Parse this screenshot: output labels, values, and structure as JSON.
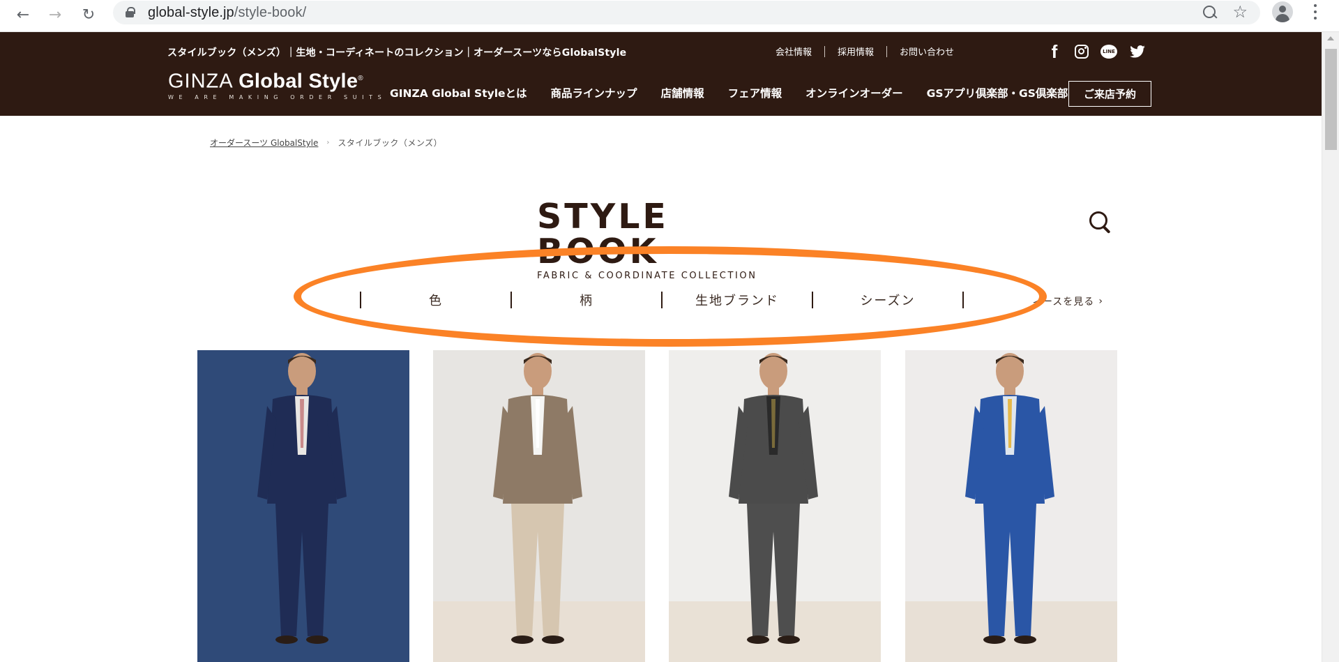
{
  "browser": {
    "url_domain": "global-style.jp",
    "url_path": "/style-book/"
  },
  "header": {
    "tagline": "スタイルブック（メンズ）｜生地・コーディネートのコレクション｜オーダースーツならGlobalStyle",
    "logo_part1": "GINZA ",
    "logo_part2": "Global Style",
    "logo_mark": "®",
    "logo_sub": "WE ARE MAKING ORDER SUITS",
    "util_links": [
      "会社情報",
      "採用情報",
      "お問い合わせ"
    ],
    "social": [
      "facebook-icon",
      "instagram-icon",
      "line-icon",
      "twitter-icon"
    ],
    "nav": [
      "GINZA Global Styleとは",
      "商品ラインナップ",
      "店舗情報",
      "フェア情報",
      "オンラインオーダー",
      "GSアプリ倶楽部・GS倶楽部"
    ],
    "reserve_label": "ご来店予約",
    "bg_color": "#2e1a12"
  },
  "breadcrumb": {
    "home": "オーダースーツ GlobalStyle",
    "separator": "›",
    "current": "スタイルブック（メンズ）"
  },
  "page": {
    "title": "STYLE BOOK",
    "subtitle": "FABRIC & COORDINATE COLLECTION"
  },
  "filters": {
    "tabs": [
      "色",
      "柄",
      "生地ブランド",
      "シーズン"
    ],
    "see_all": "ィースを見る"
  },
  "annotation_color": "#fb8226",
  "cards": [
    {
      "bg": "#2f4a78",
      "jacket": "#1f2c55",
      "trouser": "#1f2c55",
      "shirt": "#e9e7e4",
      "accent": "#c98a8a",
      "floor": "#2f4a78"
    },
    {
      "bg": "#e7e5e2",
      "jacket": "#8e7a66",
      "trouser": "#d6c6b0",
      "shirt": "#f5f5f3",
      "accent": "#ffffff",
      "floor": "#e8dfd4"
    },
    {
      "bg": "#efeeec",
      "jacket": "#4b4b4b",
      "trouser": "#4e4e4e",
      "shirt": "#2a2a2a",
      "accent": "#7a6b3a",
      "floor": "#e9e1d6"
    },
    {
      "bg": "#eeeceb",
      "jacket": "#2a56a6",
      "trouser": "#2a56a6",
      "shirt": "#dfe6ee",
      "accent": "#e5b84a",
      "floor": "#e8e0d6"
    }
  ]
}
